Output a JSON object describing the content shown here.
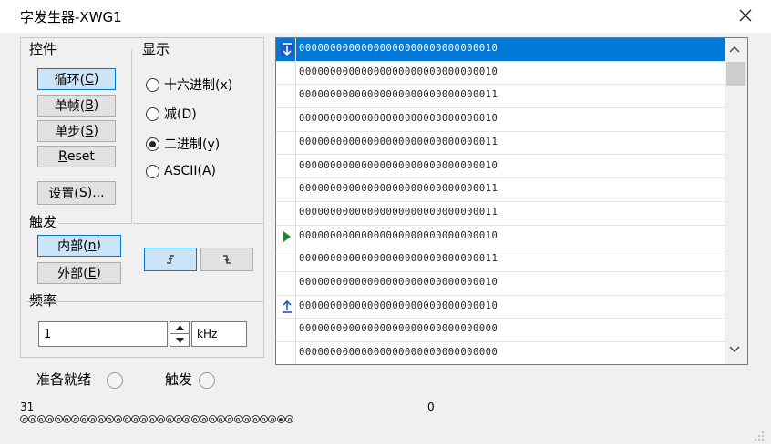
{
  "window": {
    "title": "字发生器-XWG1"
  },
  "controls": {
    "group_label": "控件",
    "buttons": [
      {
        "label": "循环(",
        "mnemonic": "C",
        "suffix": ")",
        "active": true
      },
      {
        "label": "单帧(",
        "mnemonic": "B",
        "suffix": ")",
        "active": false
      },
      {
        "label": "单步(",
        "mnemonic": "S",
        "suffix": ")",
        "active": false
      },
      {
        "label": "",
        "mnemonic": "R",
        "suffix": "eset",
        "active": false
      }
    ],
    "settings": {
      "label": "设置(",
      "mnemonic": "S",
      "suffix": ")..."
    }
  },
  "display": {
    "group_label": "显示",
    "options": [
      {
        "label": "十六进制(",
        "mnemonic": "x",
        "suffix": ")",
        "selected": false
      },
      {
        "label": "减(",
        "mnemonic": "D",
        "suffix": ")",
        "selected": false
      },
      {
        "label": "二进制(",
        "mnemonic": "y",
        "suffix": ")",
        "selected": true
      },
      {
        "label": "ASCII(",
        "mnemonic": "A",
        "suffix": ")",
        "selected": false
      }
    ]
  },
  "trigger": {
    "group_label": "触发",
    "internal": {
      "label": "内部(",
      "mnemonic": "n",
      "suffix": ")",
      "active": true
    },
    "external": {
      "label": "外部(",
      "mnemonic": "E",
      "suffix": ")",
      "active": false
    },
    "edge_rising": {
      "glyph": "↗",
      "active": true
    },
    "edge_falling": {
      "glyph": "↘",
      "active": false
    }
  },
  "frequency": {
    "group_label": "频率",
    "value": "1",
    "unit": "kHz"
  },
  "words": {
    "rows": [
      {
        "value": "00000000000000000000000000000010",
        "marker": "start",
        "selected": true
      },
      {
        "value": "00000000000000000000000000000010",
        "marker": "",
        "selected": false
      },
      {
        "value": "00000000000000000000000000000011",
        "marker": "",
        "selected": false
      },
      {
        "value": "00000000000000000000000000000010",
        "marker": "",
        "selected": false
      },
      {
        "value": "00000000000000000000000000000011",
        "marker": "",
        "selected": false
      },
      {
        "value": "00000000000000000000000000000010",
        "marker": "",
        "selected": false
      },
      {
        "value": "00000000000000000000000000000011",
        "marker": "",
        "selected": false
      },
      {
        "value": "00000000000000000000000000000011",
        "marker": "",
        "selected": false
      },
      {
        "value": "00000000000000000000000000000010",
        "marker": "current",
        "selected": false
      },
      {
        "value": "00000000000000000000000000000011",
        "marker": "",
        "selected": false
      },
      {
        "value": "00000000000000000000000000000010",
        "marker": "",
        "selected": false
      },
      {
        "value": "00000000000000000000000000000010",
        "marker": "end",
        "selected": false
      },
      {
        "value": "00000000000000000000000000000000",
        "marker": "",
        "selected": false
      },
      {
        "value": "00000000000000000000000000000000",
        "marker": "",
        "selected": false
      }
    ],
    "scroll_position": 0.0
  },
  "status": {
    "ready_label": "准备就绪",
    "trigger_label": "触发"
  },
  "bits": {
    "msb_label": "31",
    "lsb_label": "0",
    "count": 32,
    "values": [
      0,
      0,
      0,
      0,
      0,
      0,
      0,
      0,
      0,
      0,
      0,
      0,
      0,
      0,
      0,
      0,
      0,
      0,
      0,
      0,
      0,
      0,
      0,
      0,
      0,
      0,
      0,
      0,
      0,
      0,
      1,
      0
    ]
  },
  "colors": {
    "accent": "#0078d7",
    "selected_button": "#cce4f7",
    "current_marker": "#1a8a1a",
    "start_marker": "#1f57c8"
  }
}
